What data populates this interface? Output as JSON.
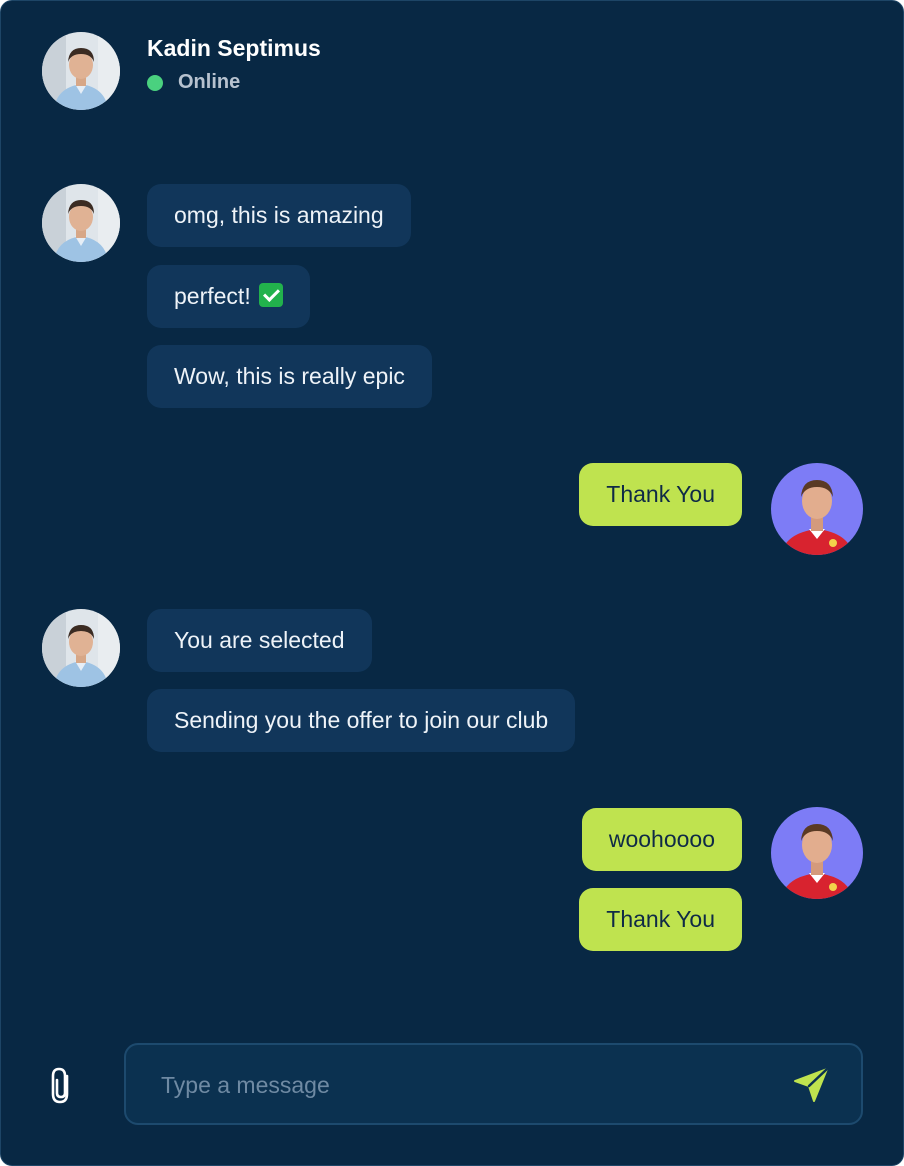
{
  "header": {
    "name": "Kadin Septimus",
    "status": "Online"
  },
  "messages": [
    {
      "direction": "in",
      "text": "omg, this is amazing"
    },
    {
      "direction": "in",
      "text": "perfect!"
    },
    {
      "direction": "in",
      "text": "Wow, this is really epic"
    },
    {
      "direction": "out",
      "text": "Thank You"
    },
    {
      "direction": "in",
      "text": "You are selected"
    },
    {
      "direction": "in",
      "text": "Sending you the offer to join our club"
    },
    {
      "direction": "out",
      "text": "woohoooo"
    },
    {
      "direction": "out",
      "text": "Thank You"
    }
  ],
  "composer": {
    "placeholder": "Type a message",
    "value": ""
  },
  "icons": {
    "attach": "paperclip-icon",
    "send": "send-icon",
    "check_emoji": "check-mark-button-emoji"
  },
  "colors": {
    "background": "#082844",
    "incoming_bubble": "#11365a",
    "outgoing_bubble": "#bfe34f",
    "online": "#4ad17f",
    "accent": "#bfe34f",
    "user_avatar_bg": "#7d7cf6"
  }
}
